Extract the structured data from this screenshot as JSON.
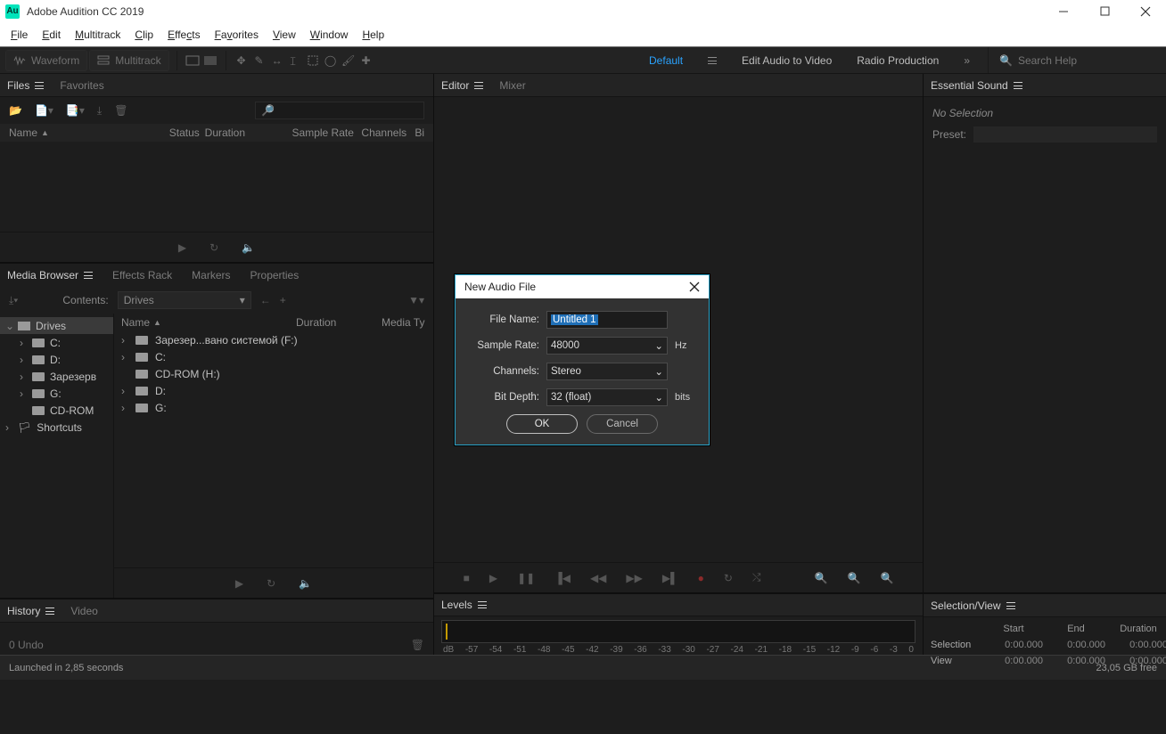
{
  "app": {
    "title": "Adobe Audition CC 2019",
    "badge": "Au"
  },
  "menu": {
    "file": "File",
    "edit": "Edit",
    "multitrack": "Multitrack",
    "clip": "Clip",
    "effects": "Effects",
    "favorites": "Favorites",
    "view": "View",
    "window": "Window",
    "help": "Help"
  },
  "option_bar": {
    "waveform": "Waveform",
    "multitrack": "Multitrack",
    "workspaces": {
      "default": "Default",
      "eav": "Edit Audio to Video",
      "radio": "Radio Production"
    },
    "search_placeholder": "Search Help"
  },
  "panels": {
    "files": {
      "tab_files": "Files",
      "tab_fav": "Favorites",
      "cols": {
        "name": "Name",
        "status": "Status",
        "duration": "Duration",
        "sample_rate": "Sample Rate",
        "channels": "Channels",
        "bit": "Bi"
      }
    },
    "media_browser": {
      "tab_mb": "Media Browser",
      "tab_er": "Effects Rack",
      "tab_mk": "Markers",
      "tab_pr": "Properties",
      "contents_label": "Contents:",
      "contents_value": "Drives",
      "tree": {
        "drives": "Drives",
        "c": "C:",
        "d": "D:",
        "reserved": "Зарезерв",
        "g": "G:",
        "cdrom": "CD-ROM",
        "shortcuts": "Shortcuts"
      },
      "list_cols": {
        "name": "Name",
        "duration": "Duration",
        "media_ty": "Media Ty"
      },
      "list": {
        "r1": "Зарезер...вано системой (F:)",
        "r2": "C:",
        "r3": "CD-ROM (H:)",
        "r4": "D:",
        "r5": "G:"
      }
    },
    "history": {
      "tab_h": "History",
      "tab_v": "Video",
      "undo": "0 Undo"
    },
    "editor": {
      "tab_e": "Editor",
      "tab_m": "Mixer"
    },
    "levels": {
      "tab": "Levels",
      "db_label": "dB",
      "scale": [
        "-57",
        "-54",
        "-51",
        "-48",
        "-45",
        "-42",
        "-39",
        "-36",
        "-33",
        "-30",
        "-27",
        "-24",
        "-21",
        "-18",
        "-15",
        "-12",
        "-9",
        "-6",
        "-3",
        "0"
      ]
    },
    "essential_sound": {
      "tab": "Essential Sound",
      "no_selection": "No Selection",
      "preset_label": "Preset:"
    },
    "selection_view": {
      "tab": "Selection/View",
      "hdr_start": "Start",
      "hdr_end": "End",
      "hdr_dur": "Duration",
      "row_sel": "Selection",
      "row_view": "View",
      "v": "0:00.000"
    }
  },
  "dialog": {
    "title": "New Audio File",
    "file_name_label": "File Name:",
    "file_name_value": "Untitled 1",
    "sample_rate_label": "Sample Rate:",
    "sample_rate_value": "48000",
    "hz": "Hz",
    "channels_label": "Channels:",
    "channels_value": "Stereo",
    "bit_depth_label": "Bit Depth:",
    "bit_depth_value": "32 (float)",
    "bits": "bits",
    "ok": "OK",
    "cancel": "Cancel"
  },
  "status": {
    "launched": "Launched in 2,85 seconds",
    "free": "23,05 GB free"
  }
}
